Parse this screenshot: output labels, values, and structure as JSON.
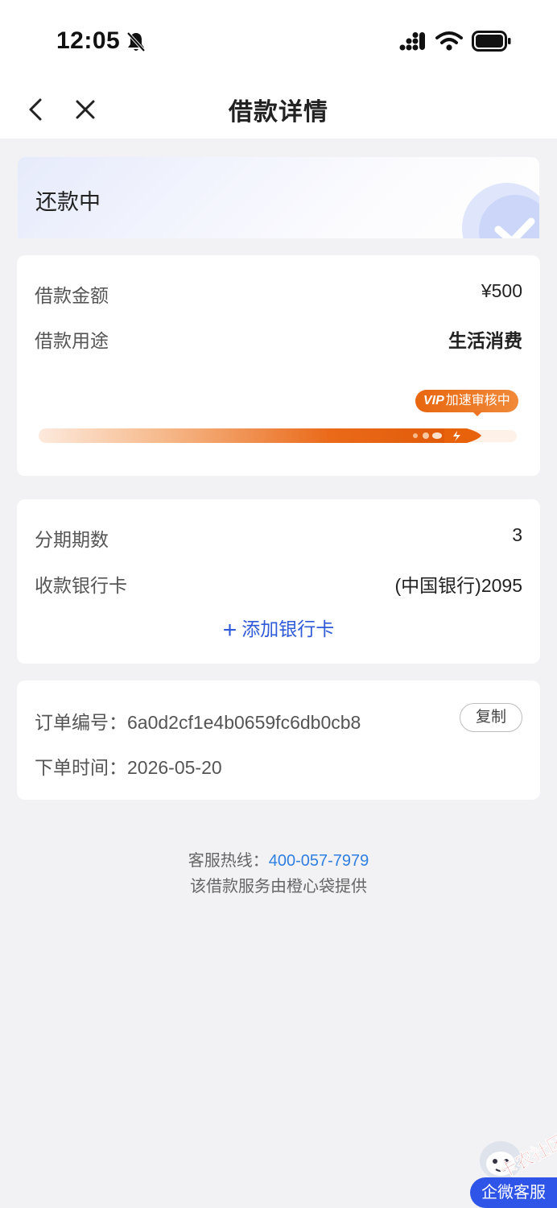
{
  "status_bar": {
    "time": "12:05"
  },
  "nav": {
    "title": "借款详情"
  },
  "status_card": {
    "status": "还款中"
  },
  "loan_card": {
    "amount_label": "借款金额",
    "amount_value": "¥500",
    "purpose_label": "借款用途",
    "purpose_value": "生活消费",
    "vip_prefix": "VIP",
    "vip_text": "加速审核中",
    "progress": 0.93
  },
  "bank_card": {
    "installments_label": "分期期数",
    "installments_value": "3",
    "bank_label": "收款银行卡",
    "bank_value": "(中国银行)2095",
    "add_card_label": "添加银行卡"
  },
  "order_card": {
    "order_no_label": "订单编号：",
    "order_no_value": "6a0d2cf1e4b0659fc6db0cb8",
    "copy_label": "复制",
    "order_time_label": "下单时间：",
    "order_time_value": "2026-05-20"
  },
  "footer": {
    "hotline_label": "客服热线：",
    "hotline_number": "400-057-7979",
    "provider_text": "该借款服务由橙心袋提供"
  },
  "floating": {
    "watermark_text": "卡农社区",
    "cs_label": "企微客服"
  },
  "colors": {
    "accent_blue": "#2f5ad8",
    "vip_orange": "#e8660f",
    "link_blue": "#2f7fe0"
  }
}
